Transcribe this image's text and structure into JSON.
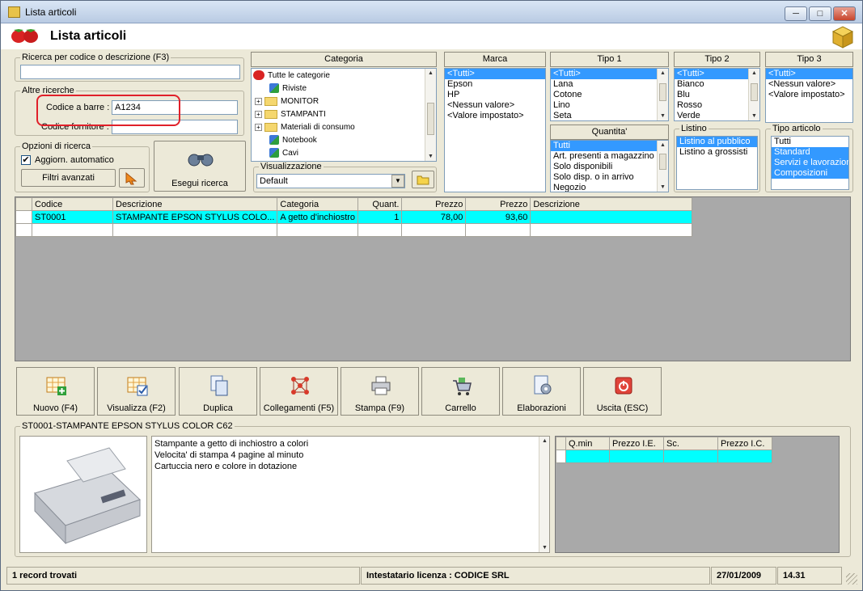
{
  "window": {
    "title": "Lista articoli",
    "btn_min": "─",
    "btn_max": "□",
    "btn_close": "✕"
  },
  "header": {
    "title": "Lista articoli"
  },
  "search": {
    "code_desc_legend": "Ricerca per codice o descrizione (F3)",
    "code_desc_value": "",
    "other_legend": "Altre ricerche",
    "barcode_label": "Codice a barre :",
    "barcode_value": "A1234",
    "supplier_label": "Codice fornitore :",
    "supplier_value": "",
    "options_legend": "Opzioni di ricerca",
    "auto_update_label": "Aggiorn. automatico",
    "auto_update_checked": true,
    "advanced_filters_label": "Filtri avanzati",
    "search_button_label": "Esegui ricerca"
  },
  "category": {
    "header": "Categoria",
    "items": [
      {
        "label": "Tutte le categorie",
        "kind": "root"
      },
      {
        "label": "Riviste",
        "kind": "pc"
      },
      {
        "label": "MONITOR",
        "kind": "folder"
      },
      {
        "label": "STAMPANTI",
        "kind": "folder"
      },
      {
        "label": "Materiali di consumo",
        "kind": "folder"
      },
      {
        "label": "Notebook",
        "kind": "pc"
      },
      {
        "label": "Cavi",
        "kind": "pc"
      }
    ]
  },
  "view": {
    "legend": "Visualizzazione",
    "value": "Default"
  },
  "marca": {
    "header": "Marca",
    "items": [
      "<Tutti>",
      "Epson",
      "HP",
      "<Nessun valore>",
      "<Valore impostato>"
    ],
    "selected": 0
  },
  "tipo1": {
    "header": "Tipo 1",
    "items": [
      "<Tutti>",
      "Lana",
      "Cotone",
      "Lino",
      "Seta"
    ],
    "selected": 0
  },
  "tipo2": {
    "header": "Tipo 2",
    "items": [
      "<Tutti>",
      "Bianco",
      "Blu",
      "Rosso",
      "Verde"
    ],
    "selected": 0
  },
  "tipo3": {
    "header": "Tipo 3",
    "items": [
      "<Tutti>",
      "<Nessun valore>",
      "<Valore impostato>"
    ],
    "selected": 0
  },
  "quantita": {
    "header": "Quantita'",
    "items": [
      "Tutti",
      "Art. presenti a magazzino",
      "Solo disponibili",
      "Solo disp. o in arrivo",
      "Negozio"
    ],
    "selected": 0
  },
  "listino": {
    "legend": "Listino",
    "items": [
      "Listino al pubblico",
      "Listino a grossisti"
    ],
    "selected": 0
  },
  "tipo_articolo": {
    "legend": "Tipo articolo",
    "items": [
      "Tutti",
      "Standard",
      "Servizi e lavorazioni",
      "Composizioni"
    ],
    "selected": [
      1,
      2,
      3
    ]
  },
  "grid": {
    "headers": [
      "Codice",
      "Descrizione",
      "Categoria",
      "Quant.",
      "Prezzo",
      "Prezzo",
      "Descrizione"
    ],
    "rows": [
      [
        "ST0001",
        "STAMPANTE EPSON STYLUS COLO...",
        "A getto d'inchiostro",
        "1",
        "78,00",
        "93,60",
        ""
      ]
    ]
  },
  "toolbar": {
    "new": "Nuovo (F4)",
    "view": "Visualizza (F2)",
    "duplicate": "Duplica",
    "links": "Collegamenti (F5)",
    "print": "Stampa (F9)",
    "cart": "Carrello",
    "process": "Elaborazioni",
    "exit": "Uscita (ESC)"
  },
  "detail": {
    "legend": "ST0001-STAMPANTE EPSON STYLUS COLOR C62",
    "notes": [
      "Stampante a getto di inchiostro a colori",
      "Velocita' di stampa 4 pagine al minuto",
      "Cartuccia nero e colore in dotazione"
    ],
    "price_headers": [
      "Q.min",
      "Prezzo I.E.",
      "Sc.",
      "Prezzo I.C."
    ]
  },
  "status": {
    "records": "1 record trovati",
    "license": "Intestatario licenza : CODICE SRL",
    "date": "27/01/2009",
    "time": "14.31"
  },
  "colors": {
    "selection": "#3399ff",
    "highlight_row": "#00ffff",
    "callout": "#e0202a"
  }
}
